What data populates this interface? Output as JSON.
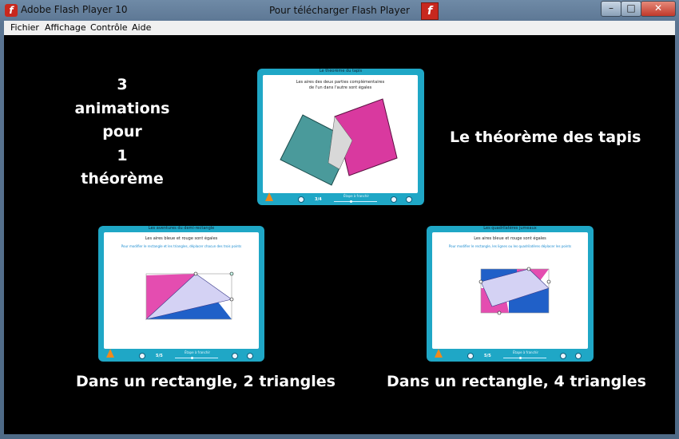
{
  "window": {
    "app_title": "Adobe Flash Player 10",
    "center_title": "Pour télécharger Flash Player",
    "flash_badge": "f",
    "controls": {
      "minimize": "–",
      "maximize": "□",
      "close": "✕"
    }
  },
  "menu": [
    "Fichier",
    "Affichage",
    "Contrôle",
    "Aide"
  ],
  "stage": {
    "left_text": [
      "3",
      "animations",
      "pour",
      "1",
      "théorème"
    ],
    "right_title": "Le théorème des tapis",
    "caption_left": "Dans un rectangle, 2 triangles",
    "caption_right": "Dans un rectangle, 4 triangles"
  },
  "thumbnails": [
    {
      "title": "Le théorème du tapis",
      "line1": "Les aires des deux parties complémentaires",
      "line2": "de l'un dans l'autre sont égales",
      "page": "3/4",
      "step": "Étape à franchir"
    },
    {
      "title": "Les aventures du demi-rectangle",
      "line1": "Les aires bleue et rouge sont égales",
      "line2": "Pour modifier le rectangle et les triangles, déplacer chacun des trois points",
      "page": "5/5",
      "step": "Étape à franchir"
    },
    {
      "title": "Les quadrilatères jumeaux",
      "line1": "Les aires bleue et rouge sont égales",
      "line2": "Pour modifier le rectangle, les lignes ou les quadrilatères déplacer les points",
      "page": "5/5",
      "step": "Étape à franchir"
    }
  ],
  "colors": {
    "teal": "#4a9a9b",
    "magenta": "#d9399f",
    "blue": "#2060c8",
    "pink": "#e44db0",
    "lavender": "#d4d2f4",
    "frame": "#1fa7c6",
    "stage": "#000000"
  }
}
